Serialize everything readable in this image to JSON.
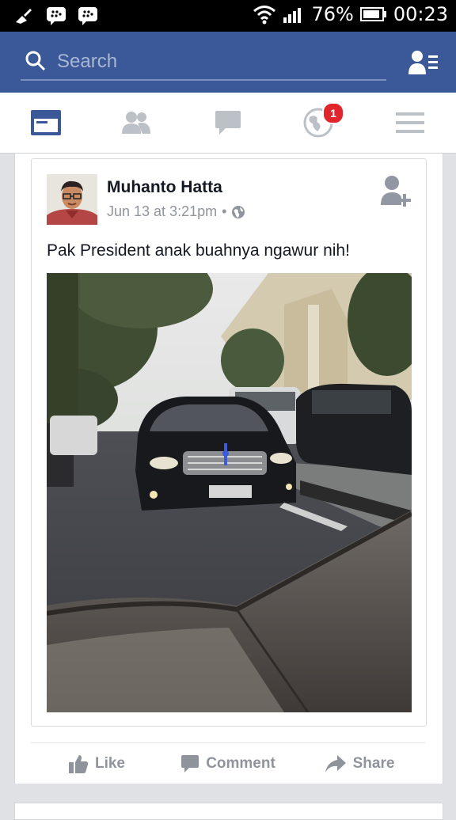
{
  "status_bar": {
    "battery": "76%",
    "time": "00:23"
  },
  "search": {
    "placeholder": "Search"
  },
  "nav": {
    "notifications_badge": "1",
    "tabs": [
      "news-feed",
      "friend-requests",
      "messages",
      "notifications",
      "more"
    ]
  },
  "post": {
    "author": "Muhanto Hatta",
    "timestamp": "Jun 13 at 3:21pm",
    "separator": "•",
    "privacy": "globe-icon",
    "text": "Pak President anak buahnya ngawur nih!",
    "actions": {
      "like": "Like",
      "comment": "Comment",
      "share": "Share"
    }
  },
  "colors": {
    "brand": "#3b5998",
    "badge": "#e0262c",
    "muted": "#90949c"
  }
}
